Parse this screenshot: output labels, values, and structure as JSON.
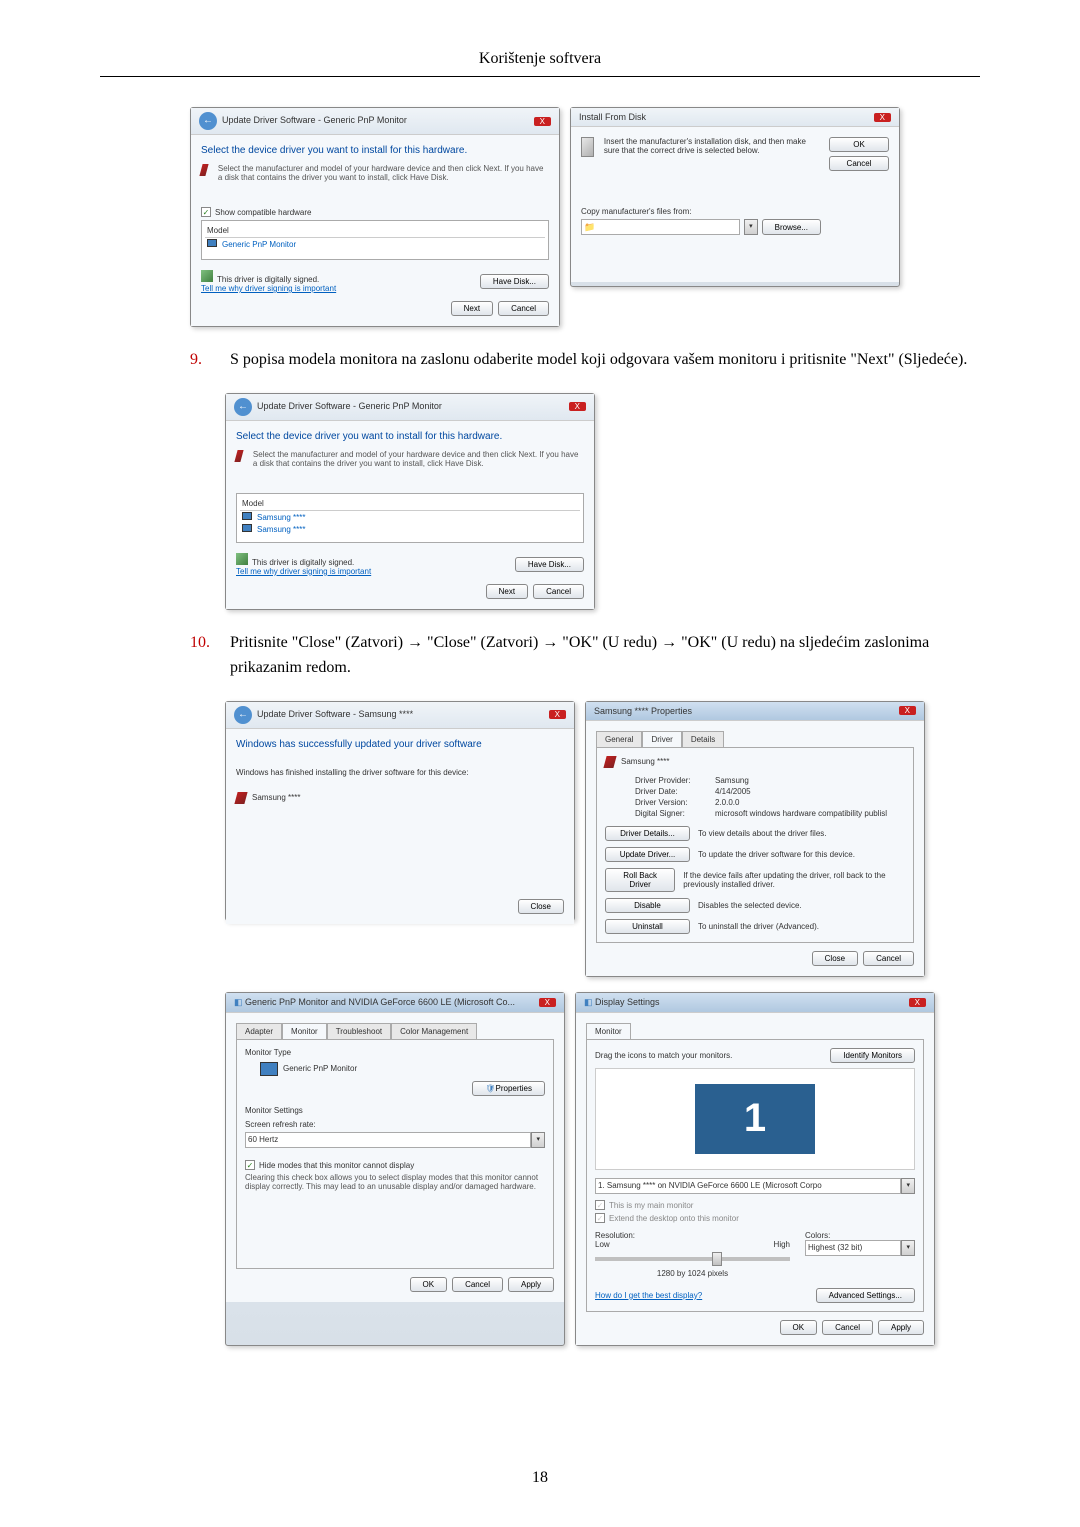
{
  "header": {
    "title": "Korištenje softvera"
  },
  "step9": {
    "number": "9.",
    "text": "S popisa modela monitora na zaslonu odaberite model koji odgovara vašem monitoru i pritisnite \"Next\" (Sljedeće)."
  },
  "step10": {
    "number": "10.",
    "text": "Pritisnite \"Close\" (Zatvori) → \"Close\" (Zatvori) → \"OK\" (U redu) → \"OK\" (U redu) na sljedećim zaslonima prikazanim redom."
  },
  "dialog1": {
    "title": "Update Driver Software - Generic PnP Monitor",
    "heading": "Select the device driver you want to install for this hardware.",
    "instruction": "Select the manufacturer and model of your hardware device and then click Next. If you have a disk that contains the driver you want to install, click Have Disk.",
    "show_compatible": "Show compatible hardware",
    "col_header": "Model",
    "item1": "Generic PnP Monitor",
    "signed_text": "This driver is digitally signed.",
    "signed_link": "Tell me why driver signing is important",
    "have_disk_btn": "Have Disk...",
    "next_btn": "Next",
    "cancel_btn": "Cancel"
  },
  "dialog2": {
    "title": "Install From Disk",
    "instruction": "Insert the manufacturer's installation disk, and then make sure that the correct drive is selected below.",
    "copy_label": "Copy manufacturer's files from:",
    "ok_btn": "OK",
    "cancel_btn": "Cancel",
    "browse_btn": "Browse..."
  },
  "dialog3": {
    "title": "Update Driver Software - Generic PnP Monitor",
    "heading": "Select the device driver you want to install for this hardware.",
    "instruction": "Select the manufacturer and model of your hardware device and then click Next. If you have a disk that contains the driver you want to install, click Have Disk.",
    "col_header": "Model",
    "item1": "Samsung ****",
    "item2": "Samsung ****",
    "signed_text": "This driver is digitally signed.",
    "signed_link": "Tell me why driver signing is important",
    "have_disk_btn": "Have Disk...",
    "next_btn": "Next",
    "cancel_btn": "Cancel"
  },
  "dialog4": {
    "title": "Update Driver Software - Samsung ****",
    "heading": "Windows has successfully updated your driver software",
    "subtext": "Windows has finished installing the driver software for this device:",
    "device": "Samsung ****",
    "close_btn": "Close"
  },
  "dialog5": {
    "title": "Samsung **** Properties",
    "tab_general": "General",
    "tab_driver": "Driver",
    "tab_details": "Details",
    "device": "Samsung ****",
    "f1_label": "Driver Provider:",
    "f1_value": "Samsung",
    "f2_label": "Driver Date:",
    "f2_value": "4/14/2005",
    "f3_label": "Driver Version:",
    "f3_value": "2.0.0.0",
    "f4_label": "Digital Signer:",
    "f4_value": "microsoft windows hardware compatibility publisl",
    "btn_details": "Driver Details...",
    "btn_details_desc": "To view details about the driver files.",
    "btn_update": "Update Driver...",
    "btn_update_desc": "To update the driver software for this device.",
    "btn_rollback": "Roll Back Driver",
    "btn_rollback_desc": "If the device fails after updating the driver, roll back to the previously installed driver.",
    "btn_disable": "Disable",
    "btn_disable_desc": "Disables the selected device.",
    "btn_uninstall": "Uninstall",
    "btn_uninstall_desc": "To uninstall the driver (Advanced).",
    "close_btn": "Close",
    "cancel_btn": "Cancel"
  },
  "dialog6": {
    "title": "Generic PnP Monitor and NVIDIA GeForce 6600 LE (Microsoft Co...",
    "tab_adapter": "Adapter",
    "tab_monitor": "Monitor",
    "tab_troubleshoot": "Troubleshoot",
    "tab_color": "Color Management",
    "section_type": "Monitor Type",
    "monitor_name": "Generic PnP Monitor",
    "properties_btn": "Properties",
    "section_settings": "Monitor Settings",
    "refresh_label": "Screen refresh rate:",
    "refresh_value": "60 Hertz",
    "hide_checkbox": "Hide modes that this monitor cannot display",
    "hide_desc": "Clearing this check box allows you to select display modes that this monitor cannot display correctly. This may lead to an unusable display and/or damaged hardware.",
    "ok_btn": "OK",
    "cancel_btn": "Cancel",
    "apply_btn": "Apply"
  },
  "dialog7": {
    "title": "Display Settings",
    "tab_monitor": "Monitor",
    "drag_text": "Drag the icons to match your monitors.",
    "identify_btn": "Identify Monitors",
    "monitor_num": "1",
    "monitor_dropdown": "1. Samsung **** on NVIDIA GeForce 6600 LE (Microsoft Corpo",
    "main_checkbox": "This is my main monitor",
    "extend_checkbox": "Extend the desktop onto this monitor",
    "resolution_label": "Resolution:",
    "res_low": "Low",
    "res_high": "High",
    "res_value": "1280 by 1024 pixels",
    "colors_label": "Colors:",
    "colors_value": "Highest (32 bit)",
    "best_link": "How do I get the best display?",
    "advanced_btn": "Advanced Settings...",
    "ok_btn": "OK",
    "cancel_btn": "Cancel",
    "apply_btn": "Apply"
  },
  "page_number": "18"
}
